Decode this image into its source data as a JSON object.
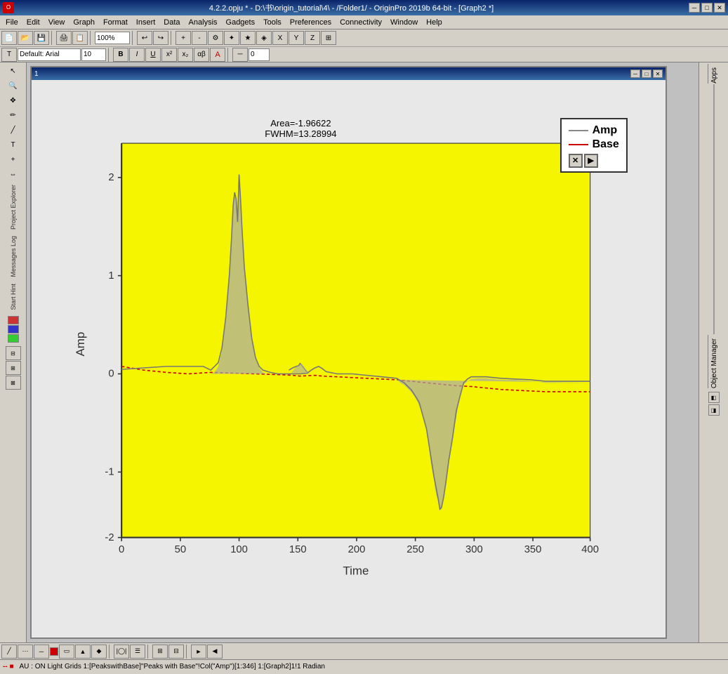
{
  "titlebar": {
    "title": "4.2.2.opju * - D:\\书\\origin_tutorial\\4\\ - /Folder1/ - OriginPro 2019b 64-bit - [Graph2 *]",
    "btn_minimize": "─",
    "btn_maximize": "□",
    "btn_close": "✕"
  },
  "menubar": {
    "items": [
      "File",
      "Edit",
      "View",
      "Graph",
      "Format",
      "Insert",
      "Data",
      "Analysis",
      "Gadgets",
      "Tools",
      "Preferences",
      "Connectivity",
      "Window",
      "Help"
    ]
  },
  "graph_window": {
    "title": "1",
    "btn_restore": "─",
    "btn_close": "✕"
  },
  "plot": {
    "area_label": "Area=-1.96622",
    "fwhm_label": "FWHM=13.28994",
    "x_axis_title": "Time",
    "y_axis_title": "Amp",
    "x_ticks": [
      "0",
      "50",
      "100",
      "150",
      "200",
      "250",
      "300",
      "350",
      "400"
    ],
    "y_ticks": [
      "-2",
      "-1",
      "0",
      "1",
      "2"
    ]
  },
  "legend": {
    "items": [
      {
        "label": "Amp",
        "color": "#666666"
      },
      {
        "label": "Base",
        "color": "#cc0000"
      }
    ]
  },
  "legend_controls": {
    "close": "✕",
    "play": "▶"
  },
  "statusbar": {
    "text": "-- ■ AU : ON  Light Grids  1:[PeakswithBase]\"Peaks with Base\"!Col(\"Amp\")[1:346]  1:[Graph2]1!1  Radian"
  },
  "apps_panel": {
    "label": "Apps"
  },
  "obj_panel": {
    "label": "Object Manager"
  }
}
